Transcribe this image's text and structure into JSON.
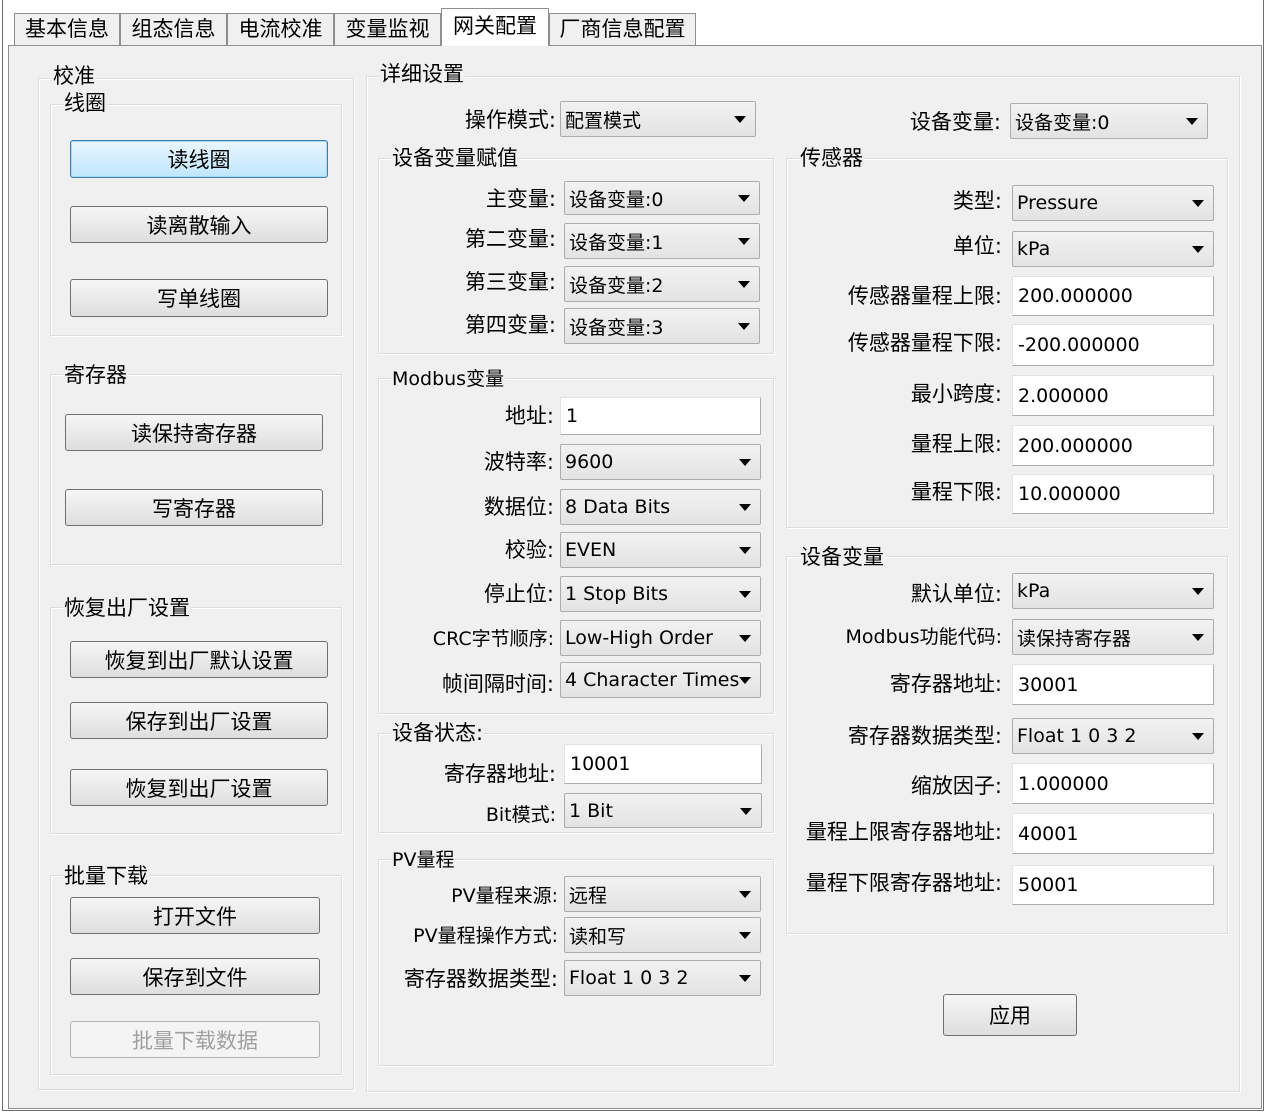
{
  "tabs": [
    "基本信息",
    "组态信息",
    "电流校准",
    "变量监视",
    "网关配置",
    "厂商信息配置"
  ],
  "calibration": {
    "title": "校准",
    "coil": {
      "title": "线圈",
      "read_coil": "读线圈",
      "read_discrete": "读离散输入",
      "write_coil": "写单线圈"
    },
    "register": {
      "title": "寄存器",
      "read_holding": "读保持寄存器",
      "write_register": "写寄存器"
    },
    "factory": {
      "title": "恢复出厂设置",
      "restore_default": "恢复到出厂默认设置",
      "save_factory": "保存到出厂设置",
      "restore_factory": "恢复到出厂设置"
    },
    "batch": {
      "title": "批量下载",
      "open_file": "打开文件",
      "save_file": "保存到文件",
      "batch_download": "批量下载数据"
    }
  },
  "detail": {
    "title": "详细设置",
    "op_mode": {
      "label": "操作模式:",
      "value": "配置模式"
    },
    "device_var": {
      "label": "设备变量:",
      "value": "设备变量:0"
    },
    "assign": {
      "title": "设备变量赋值",
      "rows": [
        {
          "label": "主变量:",
          "value": "设备变量:0"
        },
        {
          "label": "第二变量:",
          "value": "设备变量:1"
        },
        {
          "label": "第三变量:",
          "value": "设备变量:2"
        },
        {
          "label": "第四变量:",
          "value": "设备变量:3"
        }
      ]
    },
    "modbus": {
      "title": "Modbus变量",
      "address": {
        "label": "地址:",
        "value": "1"
      },
      "baud": {
        "label": "波特率:",
        "value": "9600"
      },
      "databits": {
        "label": "数据位:",
        "value": "8 Data Bits"
      },
      "parity": {
        "label": "校验:",
        "value": "EVEN"
      },
      "stopbits": {
        "label": "停止位:",
        "value": "1 Stop Bits"
      },
      "crc": {
        "label": "CRC字节顺序:",
        "value": "Low-High Order"
      },
      "frame": {
        "label": "帧间隔时间:",
        "value": "4 Character Times"
      }
    },
    "status": {
      "title": "设备状态:",
      "reg_addr": {
        "label": "寄存器地址:",
        "value": "10001"
      },
      "bit_mode": {
        "label": "Bit模式:",
        "value": "1 Bit"
      }
    },
    "pv": {
      "title": "PV量程",
      "source": {
        "label": "PV量程来源:",
        "value": "远程"
      },
      "op": {
        "label": "PV量程操作方式:",
        "value": "读和写"
      },
      "dtype": {
        "label": "寄存器数据类型:",
        "value": "Float 1 0 3 2"
      }
    },
    "sensor": {
      "title": "传感器",
      "type": {
        "label": "类型:",
        "value": "Pressure"
      },
      "unit": {
        "label": "单位:",
        "value": "kPa"
      },
      "upper": {
        "label": "传感器量程上限:",
        "value": "200.000000"
      },
      "lower": {
        "label": "传感器量程下限:",
        "value": "-200.000000"
      },
      "min_span": {
        "label": "最小跨度:",
        "value": "2.000000"
      },
      "range_upper": {
        "label": "量程上限:",
        "value": "200.000000"
      },
      "range_lower": {
        "label": "量程下限:",
        "value": "10.000000"
      }
    },
    "devvar": {
      "title": "设备变量",
      "unit": {
        "label": "默认单位:",
        "value": "kPa"
      },
      "func": {
        "label": "Modbus功能代码:",
        "value": "读保持寄存器"
      },
      "reg_addr": {
        "label": "寄存器地址:",
        "value": "30001"
      },
      "dtype": {
        "label": "寄存器数据类型:",
        "value": "Float 1 0 3 2"
      },
      "scale": {
        "label": "缩放因子:",
        "value": "1.000000"
      },
      "upper_addr": {
        "label": "量程上限寄存器地址:",
        "value": "40001"
      },
      "lower_addr": {
        "label": "量程下限寄存器地址:",
        "value": "50001"
      }
    },
    "apply": "应用"
  }
}
